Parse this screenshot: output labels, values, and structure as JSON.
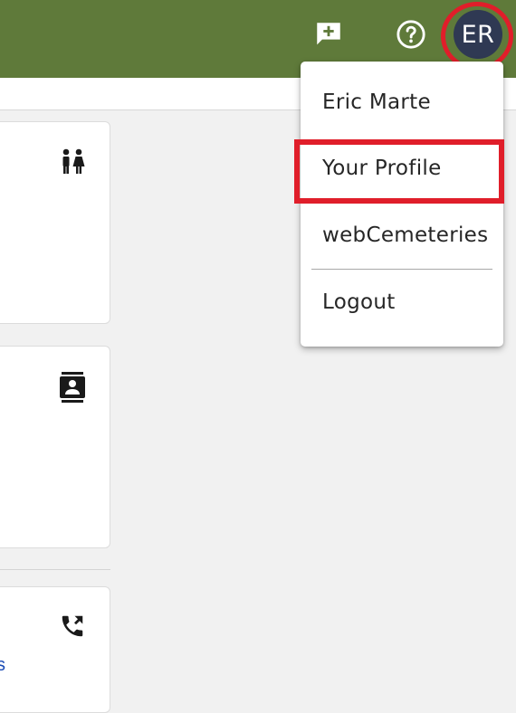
{
  "header": {
    "bar_color": "#5f7a3a",
    "feedback_icon": "add-comment-icon",
    "help_icon": "help-circle-icon",
    "user_initials": "ER",
    "avatar_color": "#2f3953"
  },
  "cards": [
    {
      "icon": "restroom-people-icon"
    },
    {
      "icon": "contact-badge-icon"
    },
    {
      "icon": "phone-forward-icon",
      "link_fragment": "s"
    }
  ],
  "user_menu": {
    "user_name": "Eric Marte",
    "profile_label": "Your Profile",
    "webcemeteries_label": "webCemeteries",
    "logout_label": "Logout"
  },
  "annotations": {
    "highlight_color": "#e01e2a"
  }
}
